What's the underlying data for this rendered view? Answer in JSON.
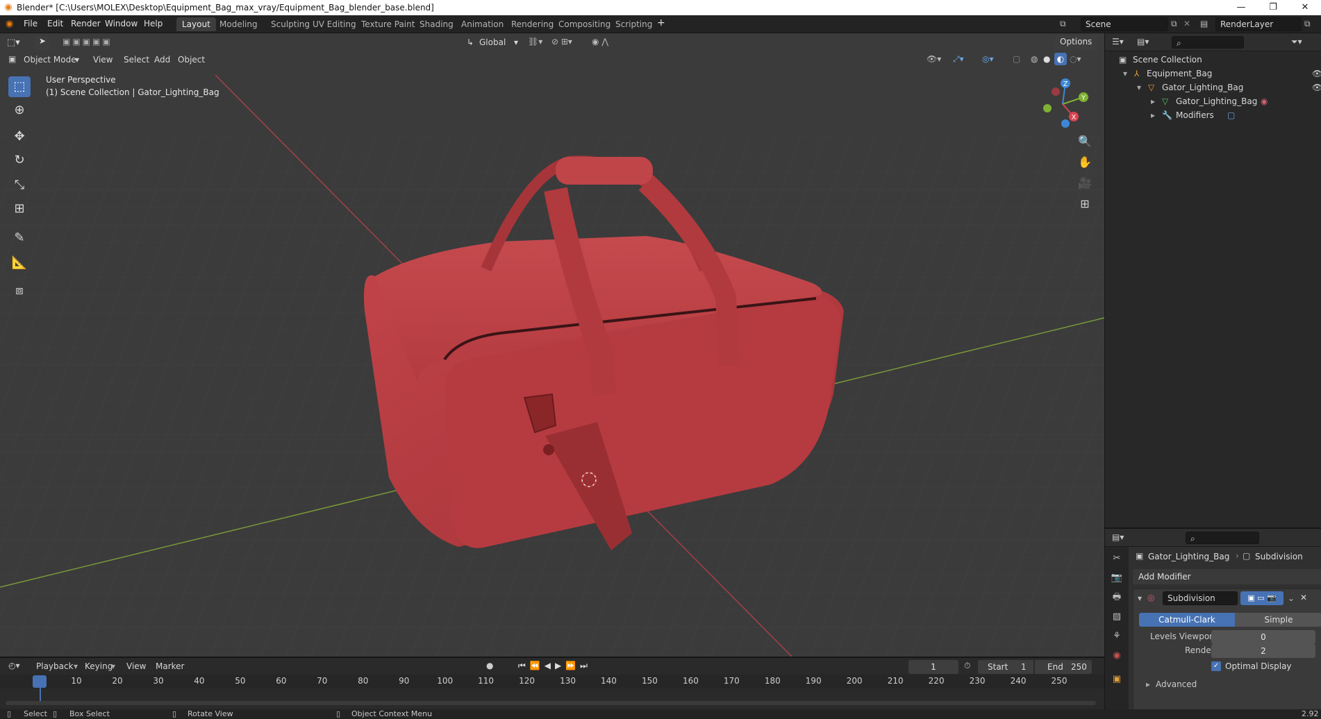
{
  "window": {
    "title": "Blender* [C:\\Users\\MOLEX\\Desktop\\Equipment_Bag_max_vray/Equipment_Bag_blender_base.blend]",
    "minimize": "—",
    "restore": "❐",
    "close": "✕"
  },
  "menu": [
    "File",
    "Edit",
    "Render",
    "Window",
    "Help"
  ],
  "workspaces": [
    "Layout",
    "Modeling",
    "Sculpting",
    "UV Editing",
    "Texture Paint",
    "Shading",
    "Animation",
    "Rendering",
    "Compositing",
    "Scripting"
  ],
  "active_workspace": "Layout",
  "add_workspace": "+",
  "scene": "Scene",
  "render_layer": "RenderLayer",
  "viewport": {
    "options_label": "Options",
    "transform_orientation": "Global",
    "mode": "Object Mode",
    "header_menus": [
      "View",
      "Select",
      "Add",
      "Object"
    ],
    "overlay_line1": "User Perspective",
    "overlay_line2": "(1) Scene Collection | Gator_Lighting_Bag",
    "gizmo_axes": {
      "x": "X",
      "y": "Y",
      "z": "Z"
    }
  },
  "colors": {
    "accent": "#4772b3",
    "bag": "#b83c40",
    "axis_x": "#d8434f",
    "axis_y": "#7fb233",
    "axis_z": "#3d87d6"
  },
  "outliner": {
    "root": "Scene Collection",
    "items": [
      {
        "label": "Equipment_Bag",
        "icon": "armature-icon"
      },
      {
        "label": "Gator_Lighting_Bag",
        "icon": "mesh-object-icon"
      },
      {
        "label": "Gator_Lighting_Bag",
        "icon": "mesh-data-icon"
      },
      {
        "label": "Modifiers",
        "icon": "wrench-icon"
      }
    ]
  },
  "properties": {
    "object_name": "Gator_Lighting_Bag",
    "modifier_crumb": "Subdivision",
    "add_modifier": "Add Modifier",
    "modifier_name": "Subdivision",
    "algorithm_options": [
      "Catmull-Clark",
      "Simple"
    ],
    "algorithm_selected": "Catmull-Clark",
    "levels_viewport_label": "Levels Viewport",
    "levels_viewport_value": "0",
    "render_label": "Render",
    "render_value": "2",
    "optimal_display": "Optimal Display",
    "advanced": "Advanced",
    "version": "2.92"
  },
  "timeline": {
    "menus": [
      "Playback",
      "Keying",
      "View",
      "Marker"
    ],
    "current_frame": "1",
    "start_label": "Start",
    "start": "1",
    "end_label": "End",
    "end": "250",
    "ticks": [
      "1",
      "10",
      "20",
      "30",
      "40",
      "50",
      "60",
      "70",
      "80",
      "90",
      "100",
      "110",
      "120",
      "130",
      "140",
      "150",
      "160",
      "170",
      "180",
      "190",
      "200",
      "210",
      "220",
      "230",
      "240",
      "250"
    ]
  },
  "statusbar": {
    "select": "Select",
    "box_select": "Box Select",
    "rotate_view": "Rotate View",
    "context_menu": "Object Context Menu"
  }
}
